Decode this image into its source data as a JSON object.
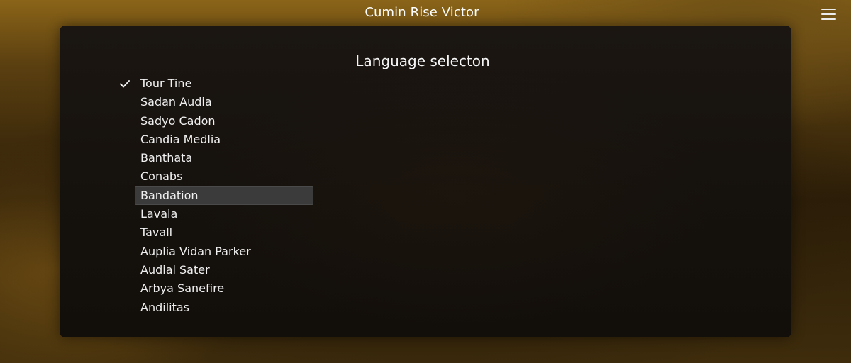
{
  "window": {
    "title": "Cumin Rise Victor"
  },
  "icons": {
    "menu": "hamburger-menu-icon",
    "check": "checkmark-icon"
  },
  "panel": {
    "title": "Language selecton"
  },
  "languages": {
    "selected_index": 0,
    "highlighted_index": 6,
    "items": [
      "Tour Tine",
      "Sadan Audia",
      "Sadyo Cadon",
      "Candia Medlia",
      "Banthata",
      "Conabs",
      "Bandation",
      "Lavaia",
      "Tavall",
      "Auplia Vidan Parker",
      "Audial Sater",
      "Arbya Sanefire",
      "Andilitas"
    ]
  },
  "colors": {
    "highlight": "#3b3b3b",
    "text": "#f0f0f0",
    "panel": "#16120e"
  }
}
